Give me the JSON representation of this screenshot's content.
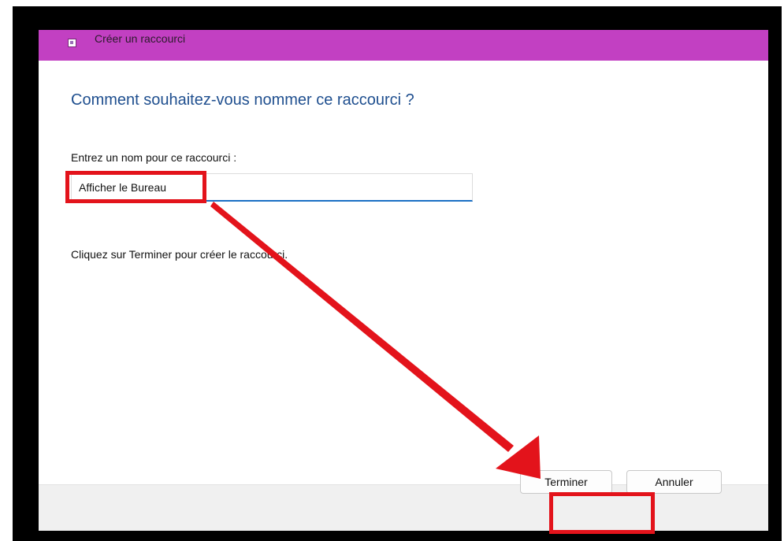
{
  "window": {
    "title": "Créer un raccourci",
    "icon": "shortcut-wizard-icon",
    "titlebar_color": "#c240c2"
  },
  "main": {
    "heading": "Comment souhaitez-vous nommer ce raccourci ?",
    "name_label": "Entrez un nom pour ce raccourci :",
    "name_value": "Afficher le Bureau",
    "info": "Cliquez sur Terminer pour créer le raccourci."
  },
  "footer": {
    "finish_label": "Terminer",
    "cancel_label": "Annuler"
  },
  "annotations": {
    "highlight_color": "#e3131b",
    "arrow_color": "#e3131b"
  }
}
